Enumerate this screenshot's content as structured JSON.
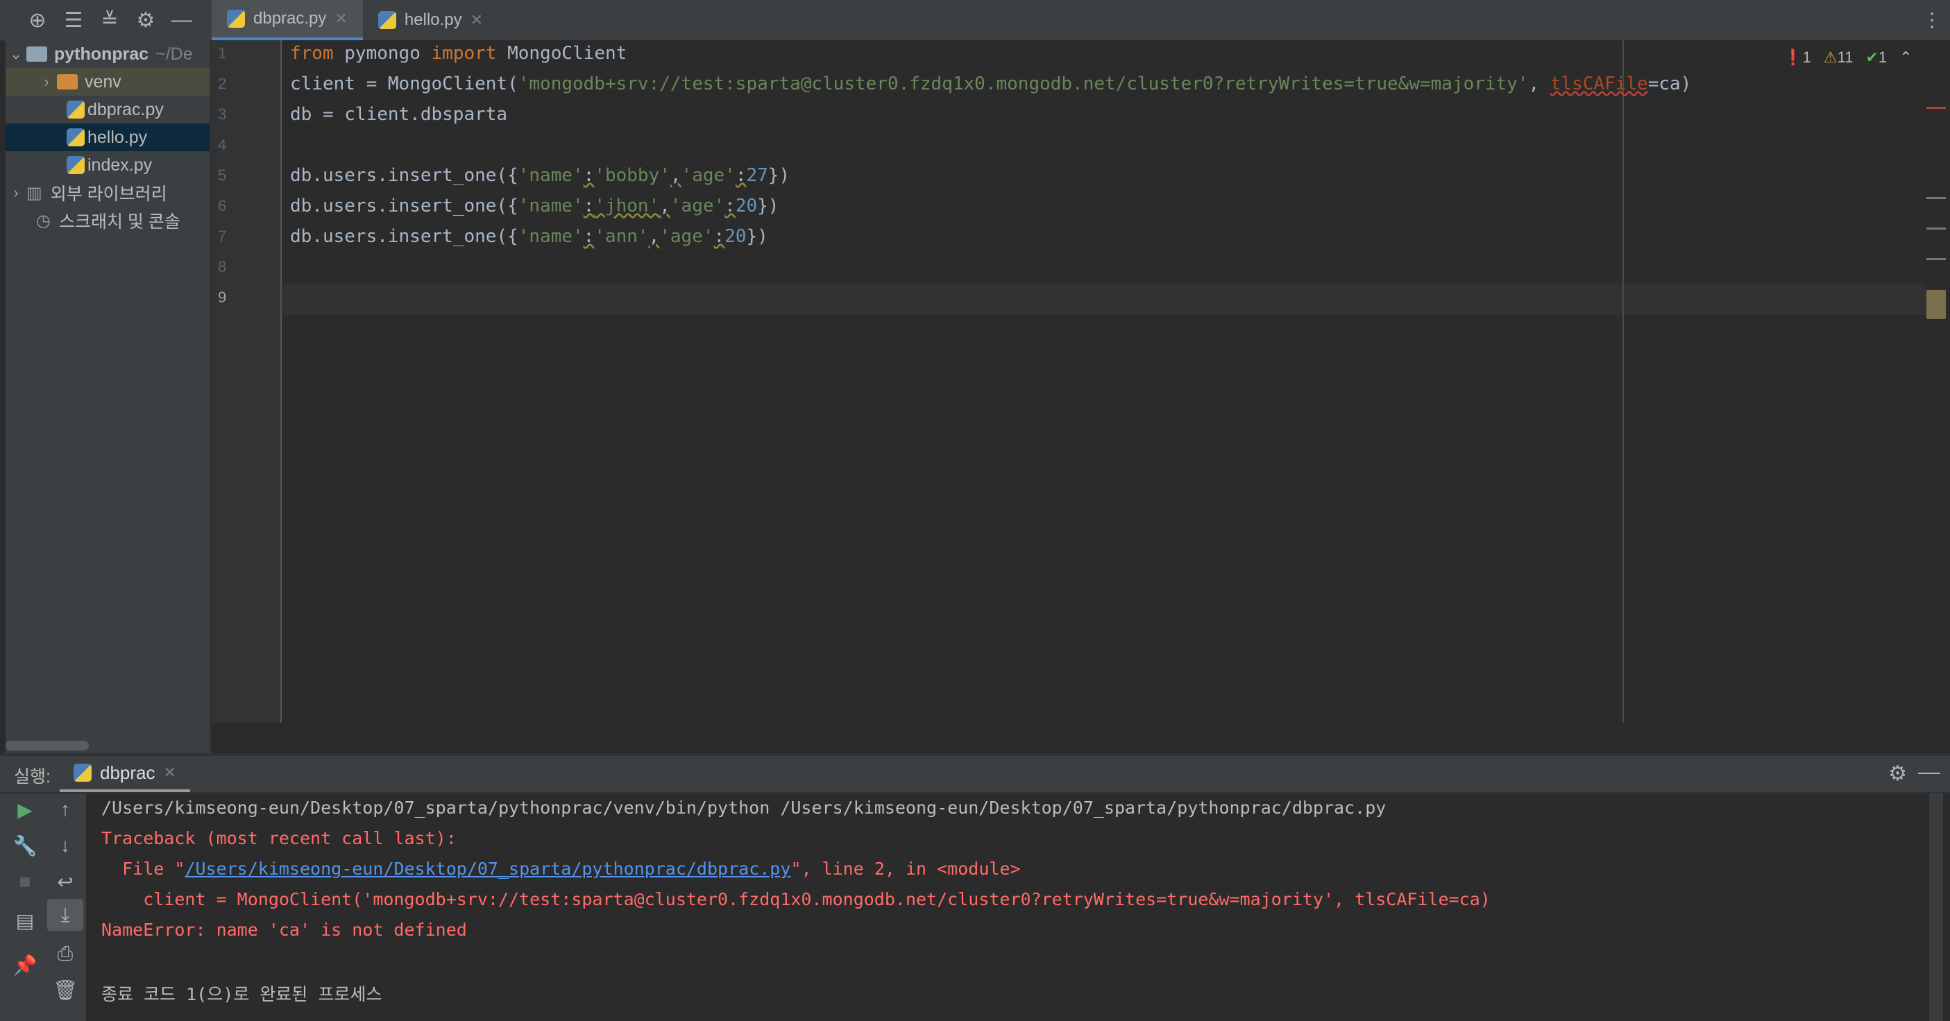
{
  "toolbar": {
    "icons": [
      "locate-icon",
      "expand-all-icon",
      "collapse-all-icon",
      "gear-icon",
      "minimize-icon"
    ]
  },
  "tabs": [
    {
      "label": "dbprac.py",
      "active": true
    },
    {
      "label": "hello.py",
      "active": false
    }
  ],
  "sidebar": {
    "project_name": "pythonprac",
    "project_path": "~/De",
    "items": [
      {
        "label": "venv",
        "type": "folder"
      },
      {
        "label": "dbprac.py",
        "type": "python-file"
      },
      {
        "label": "hello.py",
        "type": "python-file"
      },
      {
        "label": "index.py",
        "type": "python-file"
      },
      {
        "label": "외부 라이브러리",
        "type": "libraries"
      },
      {
        "label": "스크래치 및 콘솔",
        "type": "scratches"
      }
    ]
  },
  "editor": {
    "line_numbers": [
      "1",
      "2",
      "3",
      "4",
      "5",
      "6",
      "7",
      "8",
      "9"
    ],
    "current_line": "9",
    "code": {
      "l1_kw1": "from",
      "l1_mod": " pymongo ",
      "l1_kw2": "import",
      "l1_rest": " MongoClient",
      "l2_a": "client = MongoClient(",
      "l2_str": "'mongodb+srv://test:sparta@cluster0.fzdq1x0.mongodb.net/cluster0?retryWrites=true&w=majority'",
      "l2_comma": ", ",
      "l2_param": "tlsCAFile",
      "l2_end": "=ca)",
      "l3": "db = client.dbsparta",
      "l5_a": "db.users.insert_one({",
      "l5_k1": "'name'",
      "l5_c1": ":",
      "l5_v1": "'bobby'",
      "l5_c2": ",",
      "l5_k2": "'age'",
      "l5_c3": ":",
      "l5_v2": "27",
      "l5_end": "})",
      "l6_a": "db.users.insert_one({",
      "l6_k1": "'name'",
      "l6_c1": ":",
      "l6_v1": "'jhon'",
      "l6_c2": ",",
      "l6_k2": "'age'",
      "l6_c3": ":",
      "l6_v2": "20",
      "l6_end": "})",
      "l7_a": "db.users.insert_one({",
      "l7_k1": "'name'",
      "l7_c1": ":",
      "l7_v1": "'ann'",
      "l7_c2": ",",
      "l7_k2": "'age'",
      "l7_c3": ":",
      "l7_v2": "20",
      "l7_end": "})"
    },
    "inspection": {
      "errors": "1",
      "warnings": "11",
      "weak_warnings": "1"
    }
  },
  "run": {
    "label": "실행:",
    "tab": "dbprac",
    "console": {
      "cmd": "/Users/kimseong-eun/Desktop/07_sparta/pythonprac/venv/bin/python /Users/kimseong-eun/Desktop/07_sparta/pythonprac/dbprac.py",
      "traceback": "Traceback (most recent call last):",
      "file_prefix": "  File \"",
      "file_link": "/Users/kimseong-eun/Desktop/07_sparta/pythonprac/dbprac.py",
      "file_suffix": "\", line 2, in <module>",
      "code_line": "    client = MongoClient('mongodb+srv://test:sparta@cluster0.fzdq1x0.mongodb.net/cluster0?retryWrites=true&w=majority', tlsCAFile=ca)",
      "error": "NameError: name 'ca' is not defined",
      "exit": "종료 코드 1(으)로 완료된 프로세스"
    }
  },
  "colors": {
    "keyword": "#cc7832",
    "string": "#6a8759",
    "number": "#6897bb",
    "error": "#ff6b68",
    "link": "#5394ec"
  }
}
